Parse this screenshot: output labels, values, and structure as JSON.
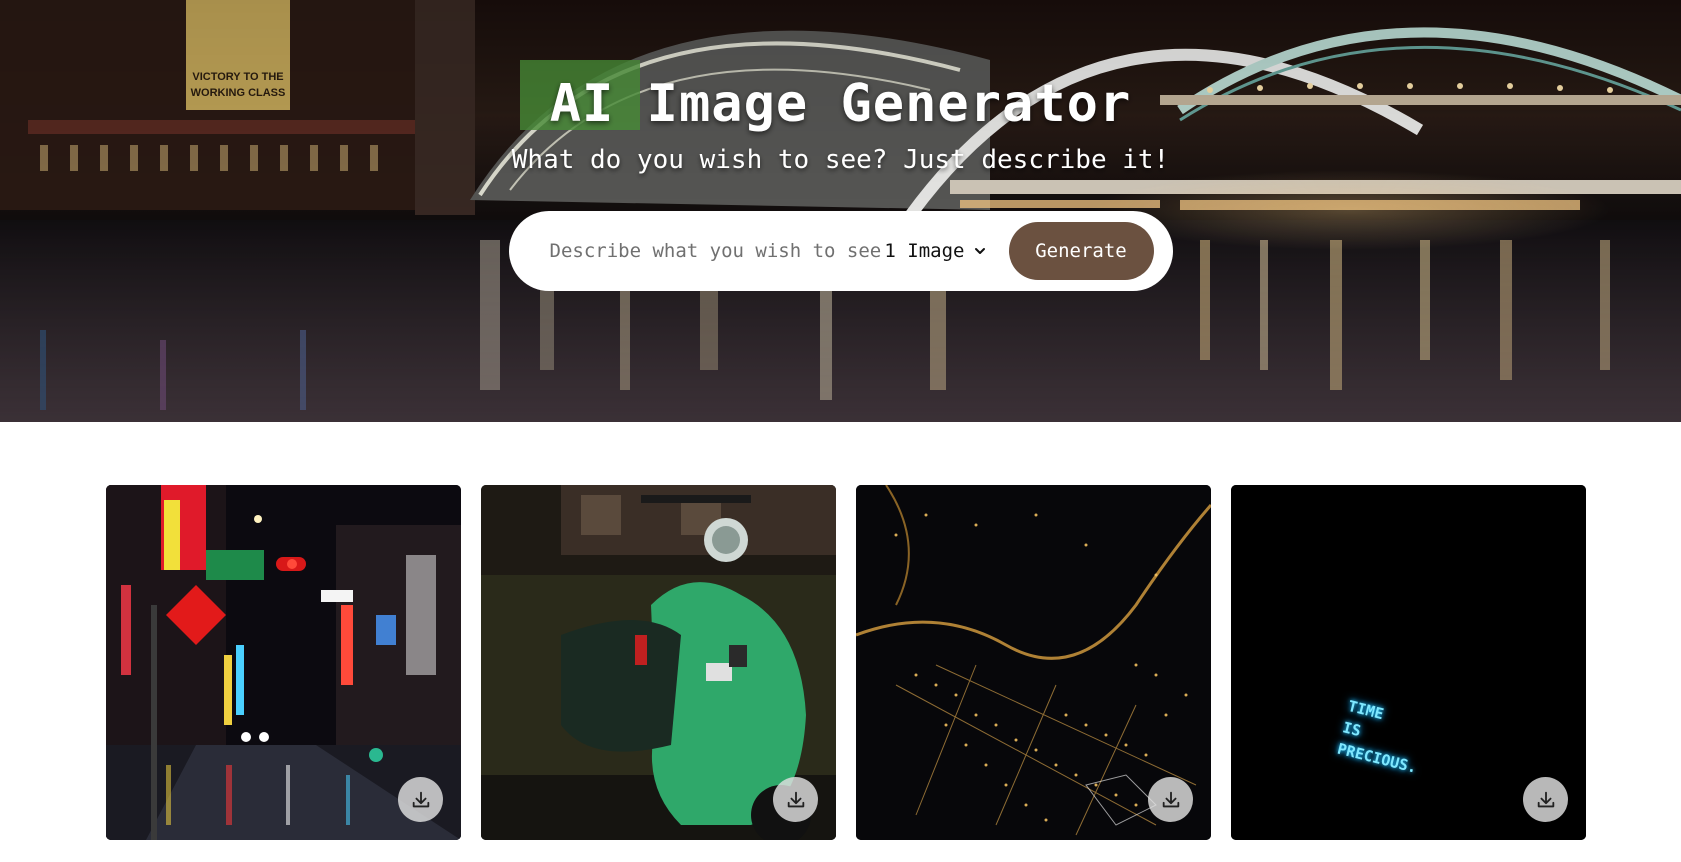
{
  "hero": {
    "title": "AI Image Generator",
    "subtitle": "What do you wish to see? Just describe it!",
    "background_scene": "night city river with illuminated bridges",
    "billboard_text": "VICTORY TO THE WORKING CLASS"
  },
  "search": {
    "placeholder": "Describe what you wish to see",
    "value": "",
    "count_selected": "1 Image",
    "generate_label": "Generate",
    "generate_color": "#6b5140"
  },
  "gallery": {
    "cards": [
      {
        "subject": "neon street at night",
        "download_icon": "download-icon"
      },
      {
        "subject": "green scooter at night",
        "download_icon": "download-icon"
      },
      {
        "subject": "aerial city lights at night",
        "download_icon": "download-icon"
      },
      {
        "subject": "neon sign on black wall",
        "neon_lines": [
          "TIME",
          "IS",
          "PRECIOUS."
        ],
        "download_icon": "download-icon"
      }
    ]
  },
  "colors": {
    "accent_brown": "#6b5140",
    "neon_blue": "#7fe8ff",
    "scooter_green": "#3fbf7a"
  }
}
